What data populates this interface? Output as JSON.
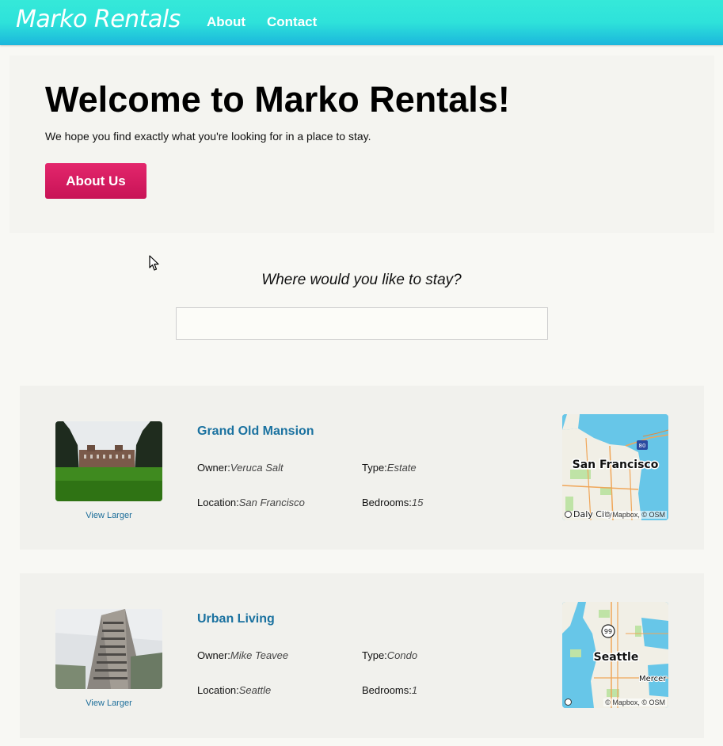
{
  "navbar": {
    "brand": "Marko Rentals",
    "links": [
      "About",
      "Contact"
    ]
  },
  "hero": {
    "title": "Welcome to Marko Rentals!",
    "subtitle": "We hope you find exactly what you're looking for in a place to stay.",
    "button_label": "About Us"
  },
  "search": {
    "prompt": "Where would you like to stay?",
    "value": "",
    "placeholder": ""
  },
  "listings": [
    {
      "title": "Grand Old Mansion",
      "view_larger": "View Larger",
      "owner_label": "Owner:",
      "owner": "Veruca Salt",
      "type_label": "Type:",
      "type": "Estate",
      "location_label": "Location:",
      "location": "San Francisco",
      "bedrooms_label": "Bedrooms:",
      "bedrooms": "15",
      "map_city": "San Francisco",
      "map_extra": "Daly City",
      "map_shield": "80",
      "map_attribution": "© Mapbox, © OSM"
    },
    {
      "title": "Urban Living",
      "view_larger": "View Larger",
      "owner_label": "Owner:",
      "owner": "Mike Teavee",
      "type_label": "Type:",
      "type": "Condo",
      "location_label": "Location:",
      "location": "Seattle",
      "bedrooms_label": "Bedrooms:",
      "bedrooms": "1",
      "map_city": "Seattle",
      "map_extra": "Mercer",
      "map_shield": "99",
      "map_attribution": "© Mapbox, © OSM"
    }
  ],
  "colors": {
    "navbar_top": "#35e9d9",
    "navbar_bottom": "#1bb6dc",
    "button": "#d81b60",
    "link": "#1b72a0",
    "water": "#67c6e8"
  }
}
